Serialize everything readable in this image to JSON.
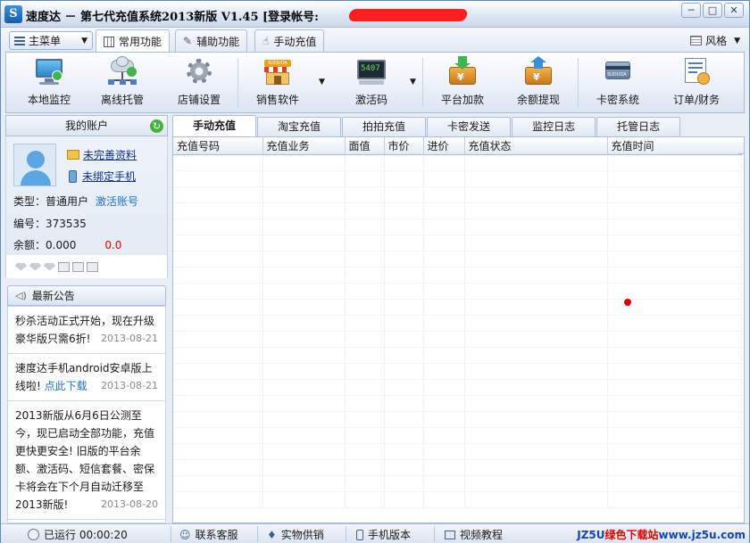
{
  "window": {
    "title": "速度达 － 第七代充值系统2013新版 V1.45  [登录帐号:",
    "logo_letter": "S",
    "buttons": {
      "minimize": "─",
      "restore": "□",
      "close": "✕"
    }
  },
  "menubar": {
    "main_menu_label": "主菜单",
    "tabs": [
      {
        "label": "常用功能",
        "icon": "grid-icon",
        "active": true
      },
      {
        "label": "辅助功能",
        "icon": "wrench-icon",
        "active": false
      },
      {
        "label": "手动充值",
        "icon": "hand-icon",
        "active": false
      }
    ],
    "skin_label": "风格"
  },
  "toolbar": {
    "items": [
      {
        "label": "本地监控",
        "icon": "monitor-icon"
      },
      {
        "label": "离线托管",
        "icon": "cloud-network-icon"
      },
      {
        "label": "店铺设置",
        "icon": "gear-icon"
      },
      {
        "label": "销售软件",
        "icon": "shop-icon"
      },
      {
        "label": "激活码",
        "icon": "terminal-icon"
      },
      {
        "label": "平台加款",
        "icon": "wallet-in-icon"
      },
      {
        "label": "余额提现",
        "icon": "wallet-out-icon"
      },
      {
        "label": "卡密系统",
        "icon": "card-icon"
      },
      {
        "label": "订单/财务",
        "icon": "order-icon"
      }
    ],
    "terminal_text": "5407",
    "shop_text": "SUDUDA",
    "card_text": "SUDUDA"
  },
  "account": {
    "header": "我的账户",
    "incomplete_profile": "未完善资料",
    "unbound_phone": "未绑定手机",
    "type_label": "类型：普通用户",
    "activate_link": "激活账号",
    "id_label": "编号：373535",
    "balance_label": "余额：0.000",
    "balance_extra": "0.0"
  },
  "notices": {
    "header": "最新公告",
    "items": [
      {
        "text": "秒杀活动正式开始，现在升级豪华版只需6折!",
        "link": "",
        "date": "2013-08-21"
      },
      {
        "text": "速度达手机android安卓版上线啦!",
        "link": "点此下载",
        "date": "2013-08-21"
      },
      {
        "text": "2013新版从6月6日公测至今，现已启动全部功能，充值更快更安全! 旧版的平台余额、激活码、短信套餐、密保卡将会在下个月自动迁移至2013新版!",
        "link": "",
        "date": "2013-08-20"
      }
    ]
  },
  "main_tabs": [
    {
      "label": "手动充值",
      "active": true
    },
    {
      "label": "淘宝充值",
      "active": false
    },
    {
      "label": "拍拍充值",
      "active": false
    },
    {
      "label": "卡密发送",
      "active": false
    },
    {
      "label": "监控日志",
      "active": false
    },
    {
      "label": "托管日志",
      "active": false
    }
  ],
  "table": {
    "columns": [
      "充值号码",
      "充值业务",
      "面值",
      "市价",
      "进价",
      "充值状态",
      "充值时间"
    ],
    "rows": []
  },
  "statusbar": {
    "running": "已运行 00:00:20",
    "items": [
      "联系客服",
      "实物供销",
      "手机版本",
      "视频教程"
    ],
    "watermark_a": "JZ5U",
    "watermark_b": "绿色下载站",
    "watermark_c": "www.jz5u.com"
  },
  "colors": {
    "accent": "#2170c8",
    "frame": "#5b8bc4",
    "alert": "#e00000"
  }
}
